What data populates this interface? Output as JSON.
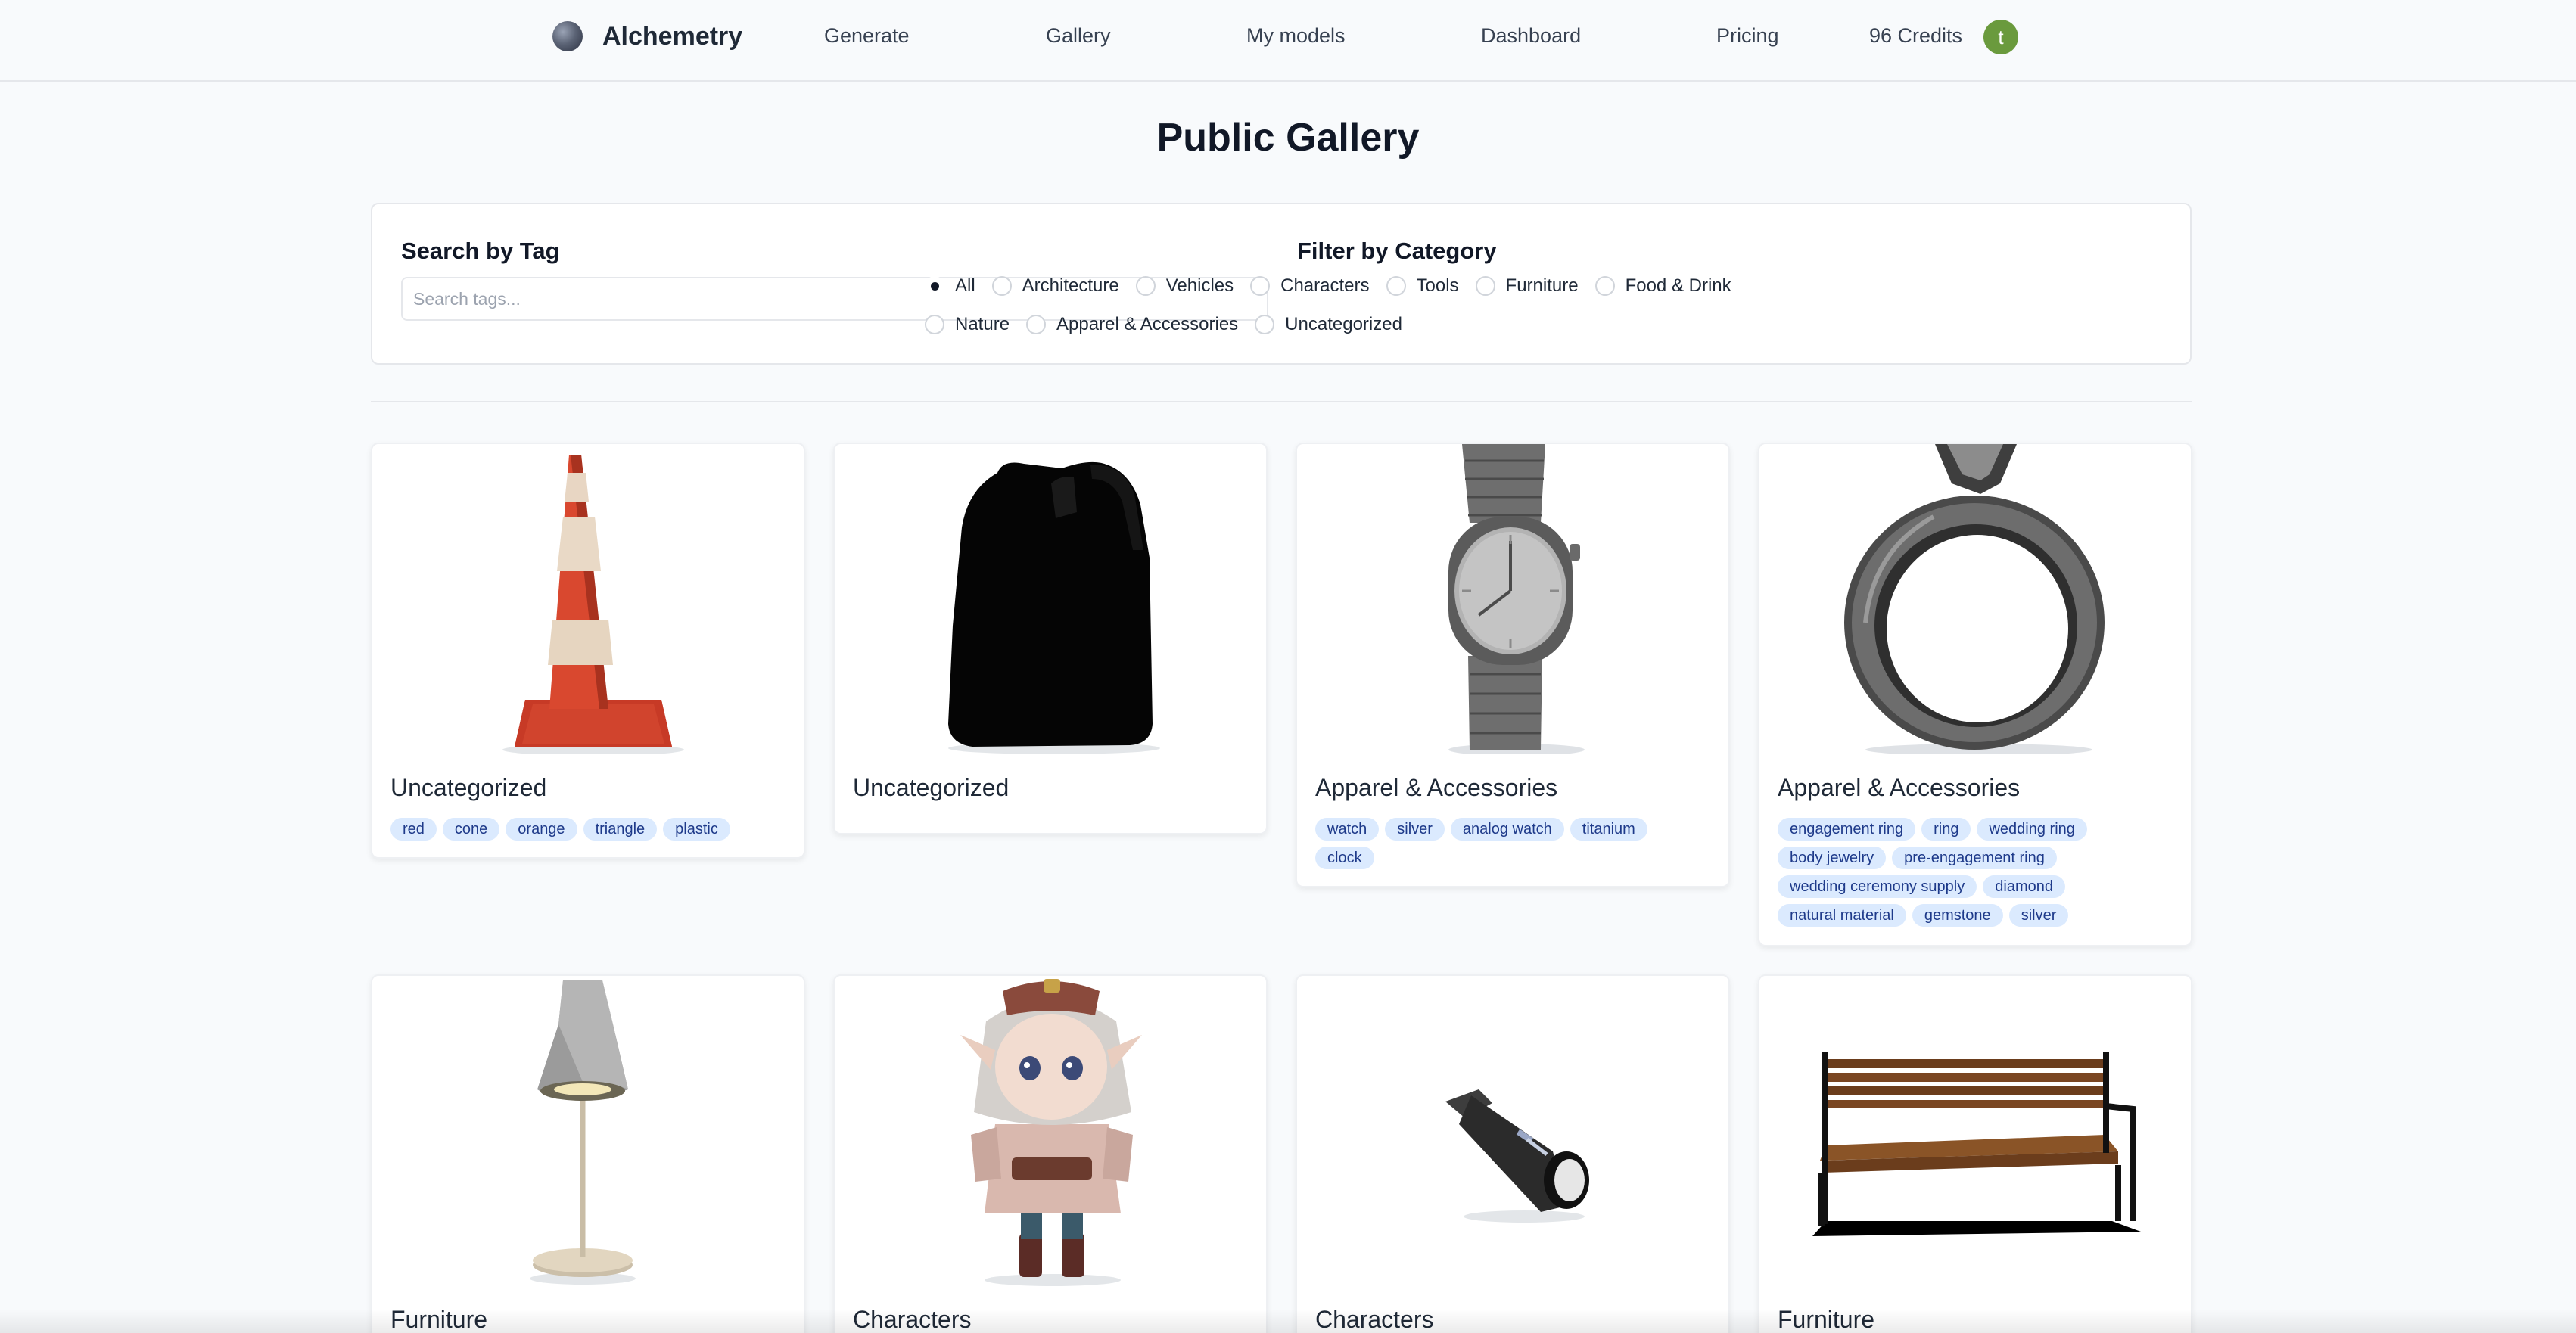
{
  "nav": {
    "brand": "Alchemetry",
    "links": [
      "Generate",
      "Gallery",
      "My models",
      "Dashboard",
      "Pricing"
    ],
    "credits": "96 Credits",
    "avatar_initial": "t",
    "avatar_color": "#6a9a3d"
  },
  "page_title": "Public Gallery",
  "search": {
    "title": "Search by Tag",
    "placeholder": "Search tags...",
    "value": ""
  },
  "filter": {
    "title": "Filter by Category",
    "selected": "All",
    "options_row1": [
      "All",
      "Architecture",
      "Vehicles",
      "Characters",
      "Tools",
      "Furniture",
      "Food & Drink"
    ],
    "options_row2": [
      "Nature",
      "Apparel & Accessories",
      "Uncategorized"
    ]
  },
  "cards": [
    {
      "title": "Uncategorized",
      "tags": [
        "red",
        "cone",
        "orange",
        "triangle",
        "plastic"
      ],
      "thumb": "traffic-cone"
    },
    {
      "title": "Uncategorized",
      "tags": [],
      "thumb": "backpack"
    },
    {
      "title": "Apparel & Accessories",
      "tags": [
        "watch",
        "silver",
        "analog watch",
        "titanium",
        "clock"
      ],
      "thumb": "watch"
    },
    {
      "title": "Apparel & Accessories",
      "tags": [
        "engagement ring",
        "ring",
        "wedding ring",
        "body jewelry",
        "pre-engagement ring",
        "wedding ceremony supply",
        "diamond",
        "natural material",
        "gemstone",
        "silver"
      ],
      "thumb": "ring"
    },
    {
      "title": "Furniture",
      "tags": [],
      "thumb": "lamp"
    },
    {
      "title": "Characters",
      "tags": [],
      "thumb": "character"
    },
    {
      "title": "Characters",
      "tags": [],
      "thumb": "lightsaber"
    },
    {
      "title": "Furniture",
      "tags": [],
      "thumb": "bench"
    }
  ],
  "colors": {
    "accent_tag_bg": "#dbeafe",
    "accent_tag_text": "#1e3a8a"
  }
}
